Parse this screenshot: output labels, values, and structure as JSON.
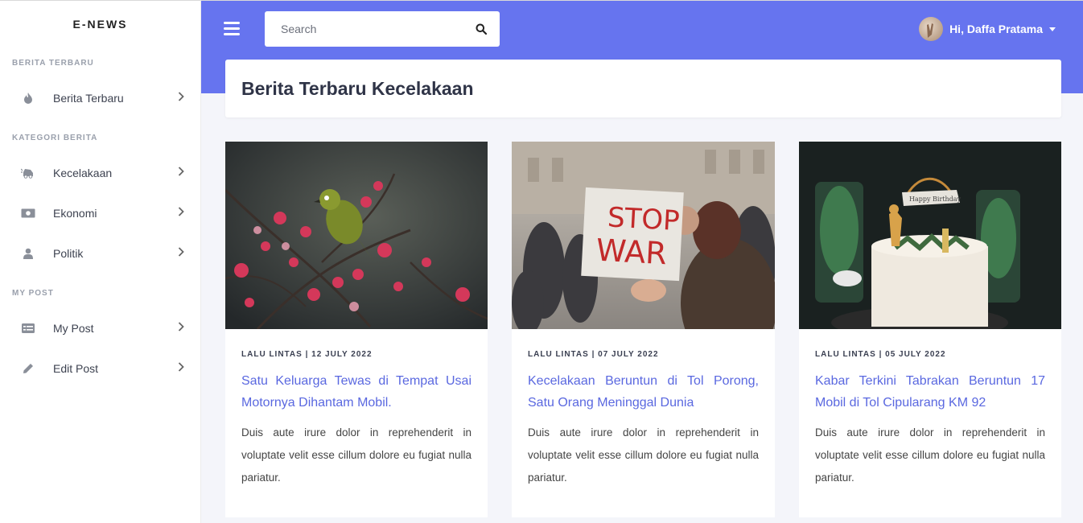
{
  "brand": "E-NEWS",
  "sidebar": {
    "sections": [
      {
        "heading": "BERITA TERBARU",
        "items": [
          {
            "label": "Berita Terbaru",
            "icon": "fire-icon"
          }
        ]
      },
      {
        "heading": "KATEGORI BERITA",
        "items": [
          {
            "label": "Kecelakaan",
            "icon": "car-crash-icon"
          },
          {
            "label": "Ekonomi",
            "icon": "money-icon"
          },
          {
            "label": "Politik",
            "icon": "user-icon"
          }
        ]
      },
      {
        "heading": "MY POST",
        "items": [
          {
            "label": "My Post",
            "icon": "list-icon"
          },
          {
            "label": "Edit Post",
            "icon": "pencil-icon"
          }
        ]
      }
    ]
  },
  "topbar": {
    "search_placeholder": "Search",
    "user_name": "Hi, Daffa Pratama",
    "accent": "#6674ef"
  },
  "page": {
    "title": "Berita Terbaru Kecelakaan"
  },
  "cards": [
    {
      "meta": "LALU LINTAS | 12 JULY 2022",
      "title": "Satu Keluarga Tewas di Tempat Usai Motornya Dihantam Mobil.",
      "text": "Duis aute irure dolor in reprehenderit in voluptate velit esse cillum dolore eu fugiat nulla pariatur."
    },
    {
      "meta": "LALU LINTAS | 07 JULY 2022",
      "title": "Kecelakaan Beruntun di Tol Porong, Satu Orang Meninggal Dunia",
      "text": "Duis aute irure dolor in reprehenderit in voluptate velit esse cillum dolore eu fugiat nulla pariatur.",
      "image_text": [
        "STOP",
        "WAR"
      ]
    },
    {
      "meta": "LALU LINTAS | 05 JULY 2022",
      "title": "Kabar Terkini Tabrakan Beruntun 17 Mobil di Tol Cipularang KM 92",
      "text": "Duis aute irure dolor in reprehenderit in voluptate velit esse cillum dolore eu fugiat nulla pariatur.",
      "image_text": [
        "Happy Birthday"
      ]
    }
  ]
}
